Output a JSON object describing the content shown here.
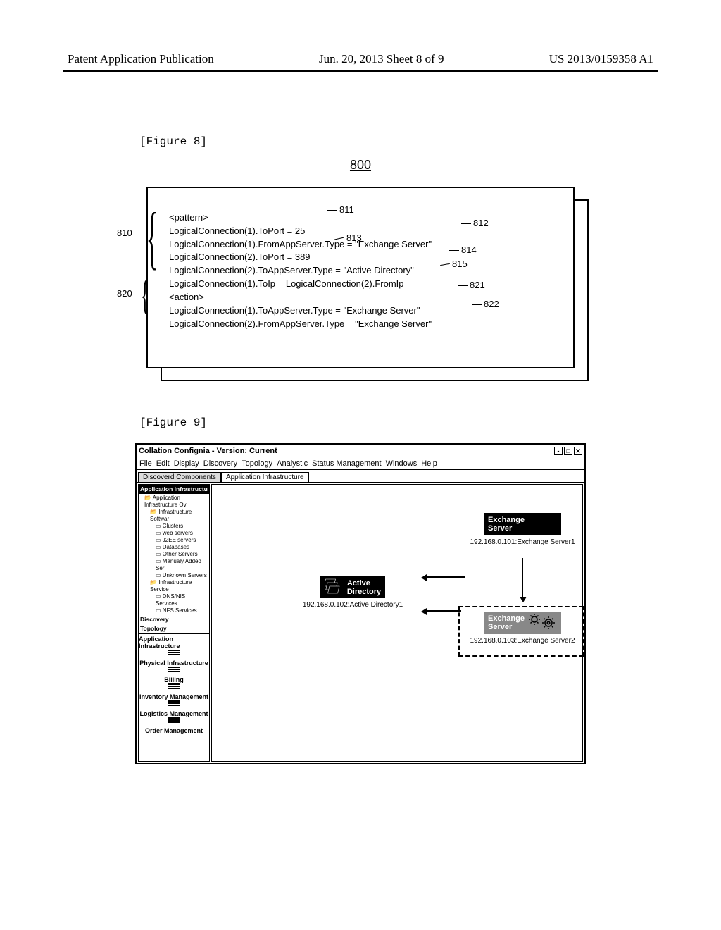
{
  "header": {
    "left": "Patent Application Publication",
    "mid": "Jun. 20, 2013  Sheet 8 of 9",
    "right": "US 2013/0159358 A1"
  },
  "fig8": {
    "caption": "[Figure 8]",
    "number": "800",
    "group_labels": {
      "g810": "810",
      "g820": "820"
    },
    "code": {
      "l0": "<pattern>",
      "l1": "LogicalConnection(1).ToPort = 25",
      "l2": "LogicalConnection(1).FromAppServer.Type = \"Exchange Server\"",
      "l3": "LogicalConnection(2).ToPort = 389",
      "l4": "LogicalConnection(2).ToAppServer.Type = \"Active Directory\"",
      "l5": "LogicalConnection(1).ToIp = LogicalConnection(2).FromIp",
      "l6": "<action>",
      "l7": "LogicalConnection(1).ToAppServer.Type = \"Exchange Server\"",
      "l8": "LogicalConnection(2).FromAppServer.Type = \"Exchange Server\""
    },
    "callouts": {
      "c811": "811",
      "c812": "812",
      "c813": "813",
      "c814": "814",
      "c815": "815",
      "c821": "821",
      "c822": "822"
    }
  },
  "fig9": {
    "caption": "[Figure 9]",
    "title": "Collation Confignia - Version: Current",
    "menu": [
      "File",
      "Edit",
      "Display",
      "Discovery",
      "Topology",
      "Analystic",
      "Status Management",
      "Windows",
      "Help"
    ],
    "tabs": {
      "t0": "Discoverd Components",
      "t1": "Application Infrastructure"
    },
    "sidebar": {
      "sec_app": "Application Infrastructu",
      "tree": {
        "a": "Application Infrastructure Ov",
        "b": "Infrastructure Softwar",
        "c": "Clusters",
        "d": "web servers",
        "e": "J2EE servers",
        "f": "Databases",
        "g": "Other Servers",
        "h": "Manualy Added Ser",
        "i": "Unknown Servers",
        "j": "Infrastructure Service",
        "k": "DNS/NIS Services",
        "l": "NFS Services"
      },
      "sec_discovery": "Discovery",
      "sec_topology": "Topology",
      "items": {
        "i0": "Application Infrastructure",
        "i1": "Physical Infrastructure",
        "i2": "Billing",
        "i3": "Inventory Management",
        "i4": "Logistics Management",
        "i5": "Order Management"
      }
    },
    "nodes": {
      "ad_label": "Active\nDirectory",
      "ad_caption": "192.168.0.102:Active Directory1",
      "ex1_label": "Exchange\nServer",
      "ex1_caption": "192.168.0.101:Exchange Server1",
      "ex2_label": "Exchange\nServer",
      "ex2_caption": "192.168.0.103:Exchange Server2"
    }
  }
}
